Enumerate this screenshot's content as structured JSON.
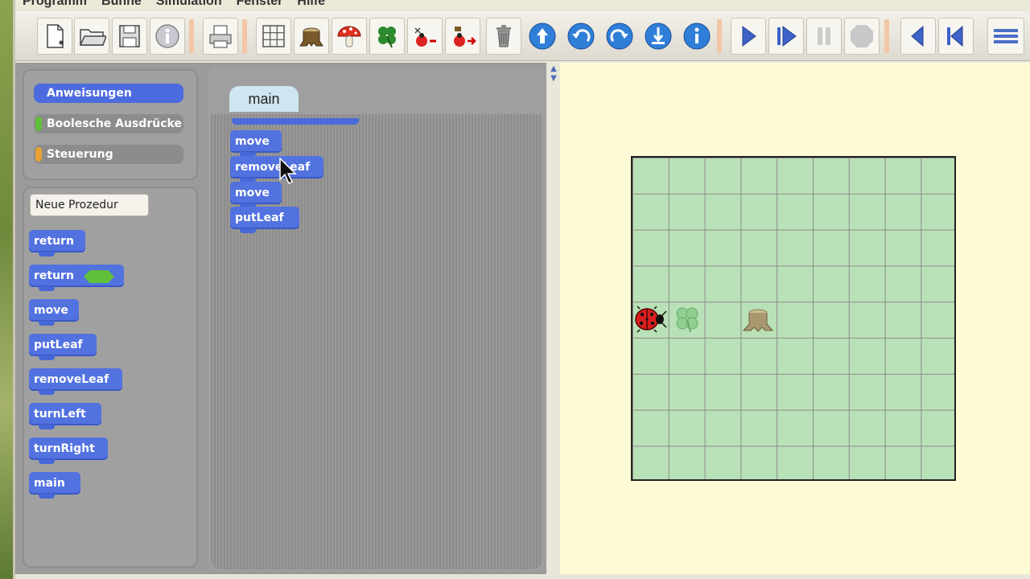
{
  "menubar": [
    "Programm",
    "Bühne",
    "Simulation",
    "Fenster",
    "Hilfe"
  ],
  "toolbar": {
    "buttons": [
      "new-file-icon",
      "open-folder-icon",
      "save-icon",
      "info-icon",
      "print-icon",
      "grid-icon",
      "tree-stump-icon",
      "mushroom-icon",
      "clover-icon",
      "ladybug-stop-icon",
      "ladybug-run-icon",
      "trash-icon",
      "arrow-up-icon",
      "turn-left-icon",
      "turn-right-icon",
      "put-down-icon",
      "pick-up-icon",
      "play-icon",
      "step-icon",
      "pause-icon",
      "stop-icon",
      "back-icon",
      "rewind-icon",
      "menu-icon"
    ]
  },
  "categories": [
    {
      "label": "Anweisungen",
      "color": "#4c6bde",
      "selected": true
    },
    {
      "label": "Boolesche Ausdrücke",
      "color": "#61c03b",
      "selected": false
    },
    {
      "label": "Steuerung",
      "color": "#e8a233",
      "selected": false
    }
  ],
  "palette": {
    "new_procedure": "Neue Prozedur",
    "blocks": [
      "return",
      "return",
      "move",
      "putLeaf",
      "removeLeaf",
      "turnLeft",
      "turnRight",
      "main"
    ]
  },
  "script": {
    "tab": "main",
    "blocks": [
      "move",
      "removeLeaf",
      "move",
      "putLeaf"
    ]
  },
  "stage": {
    "rows": 9,
    "cols": 9,
    "cell_color": "#b9e1b7"
  }
}
